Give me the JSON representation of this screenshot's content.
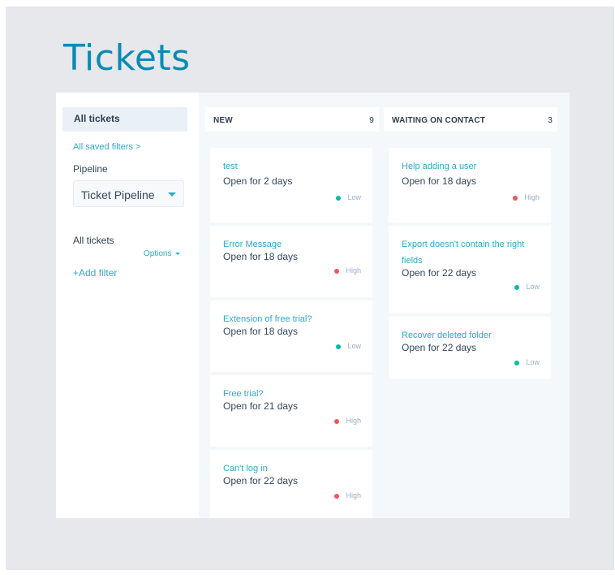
{
  "page_title": "Tickets",
  "sidebar": {
    "all_tickets": "All tickets",
    "saved_filters": "All saved filters >",
    "pipeline_label": "Pipeline",
    "pipeline_value": "Ticket Pipeline",
    "all_tickets_2": "All tickets",
    "options": "Options",
    "add_filter": "+Add filter"
  },
  "colors": {
    "accent": "#2fa9c6",
    "title": "#0b8ab4",
    "high": "#f2545b",
    "low": "#00bda5"
  },
  "columns": [
    {
      "name": "NEW",
      "count": "9",
      "cards": [
        {
          "title": "test",
          "status": "Open for 2 days",
          "priority": "Low"
        },
        {
          "title": "Error Message",
          "status": "Open for 18 days",
          "priority": "High"
        },
        {
          "title": "Extension of free trial?",
          "status": "Open for 18 days",
          "priority": "Low"
        },
        {
          "title": "Free trial?",
          "status": "Open for 21 days",
          "priority": "High"
        },
        {
          "title": "Can't log in",
          "status": "Open for 22 days",
          "priority": "High"
        }
      ]
    },
    {
      "name": "WAITING ON CONTACT",
      "count": "3",
      "cards": [
        {
          "title": "Help adding a user",
          "status": "Open for 18 days",
          "priority": "High"
        },
        {
          "title": "Export doesn't contain the right fields",
          "status": "Open for 22 days",
          "priority": "Low"
        },
        {
          "title": "Recover deleted folder",
          "status": "Open for 22 days",
          "priority": "Low"
        }
      ]
    }
  ]
}
